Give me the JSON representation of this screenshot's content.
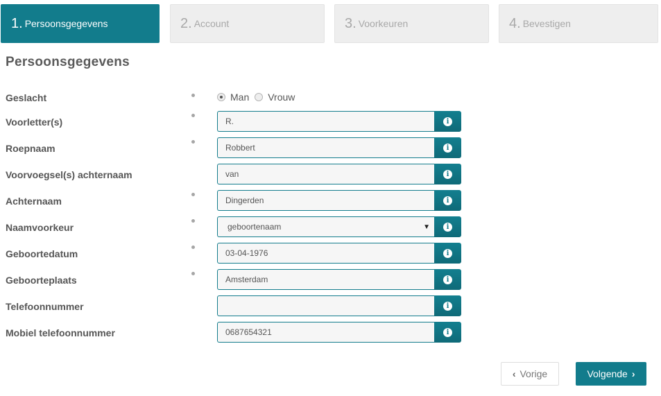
{
  "steps": [
    {
      "num": "1.",
      "label": "Persoonsgegevens",
      "active": true
    },
    {
      "num": "2.",
      "label": "Account",
      "active": false
    },
    {
      "num": "3.",
      "label": "Voorkeuren",
      "active": false
    },
    {
      "num": "4.",
      "label": "Bevestigen",
      "active": false
    }
  ],
  "page_title": "Persoonsgegevens",
  "form": {
    "gender": {
      "label": "Geslacht",
      "required": true,
      "options": [
        "Man",
        "Vrouw"
      ],
      "selected": "Man"
    },
    "fields": [
      {
        "label": "Voorletter(s)",
        "value": "R.",
        "required": true,
        "type": "text"
      },
      {
        "label": "Roepnaam",
        "value": "Robbert",
        "required": true,
        "type": "text"
      },
      {
        "label": "Voorvoegsel(s) achternaam",
        "value": "van",
        "required": false,
        "type": "text"
      },
      {
        "label": "Achternaam",
        "value": "Dingerden",
        "required": true,
        "type": "text"
      },
      {
        "label": "Naamvoorkeur",
        "value": "geboortenaam",
        "required": true,
        "type": "select"
      },
      {
        "label": "Geboortedatum",
        "value": "03-04-1976",
        "required": true,
        "type": "text"
      },
      {
        "label": "Geboorteplaats",
        "value": "Amsterdam",
        "required": true,
        "type": "text"
      },
      {
        "label": "Telefoonnummer",
        "value": "",
        "required": false,
        "type": "text"
      },
      {
        "label": "Mobiel telefoonnummer",
        "value": "0687654321",
        "required": false,
        "type": "text"
      }
    ],
    "info_icon_glyph": "i"
  },
  "nav": {
    "prev_label": "Vorige",
    "next_label": "Volgende",
    "prev_icon": "‹",
    "next_icon": "›"
  },
  "colors": {
    "accent": "#127c8c",
    "step_inactive_bg": "#eeeeee",
    "field_bg": "#f6f6f6"
  }
}
